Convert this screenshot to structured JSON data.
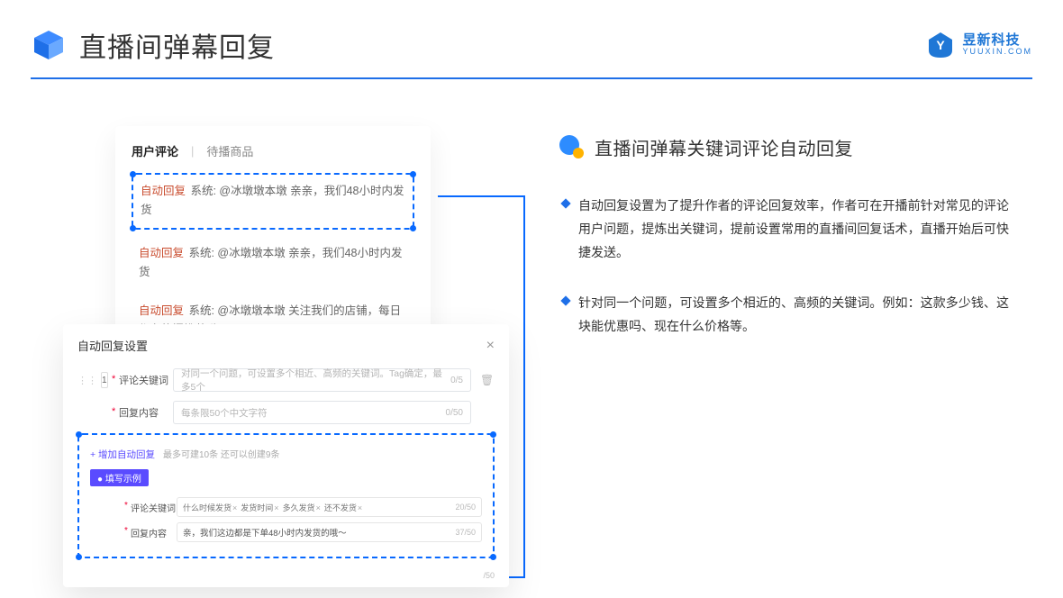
{
  "page": {
    "title": "直播间弹幕回复"
  },
  "brand": {
    "cn": "昱新科技",
    "en": "YUUXIN.COM"
  },
  "card": {
    "tab_active": "用户评论",
    "tab_inactive": "待播商品",
    "msg1_badge": "自动回复",
    "msg1_text": " 系统: @冰墩墩本墩 亲亲，我们48小时内发货",
    "msg2_badge": "自动回复",
    "msg2_text": " 系统: @冰墩墩本墩 亲亲，我们48小时内发货",
    "msg3_badge": "自动回复",
    "msg3_text": " 系统: @冰墩墩本墩 关注我们的店铺，每日都有热门推荐呦～"
  },
  "modal": {
    "title": "自动回复设置",
    "index": "1",
    "row1_label": "评论关键词",
    "row1_placeholder": "对同一个问题，可设置多个相近、高频的关键词。Tag确定，最多5个",
    "row1_count": "0/5",
    "row2_label": "回复内容",
    "row2_placeholder": "每条限50个中文字符",
    "row2_count": "0/50",
    "add_link": "+ 增加自动回复",
    "add_hint": "最多可建10条 还可以创建9条",
    "pill": "● 填写示例",
    "ex_row1_label": "评论关键词",
    "ex_tags": [
      "什么时候发货",
      "发货时间",
      "多久发货",
      "还不发货"
    ],
    "ex_row1_count": "20/50",
    "ex_row2_label": "回复内容",
    "ex_row2_value": "亲，我们这边都是下单48小时内发货的哦～",
    "ex_row2_count": "37/50",
    "bottom_count": "/50"
  },
  "section": {
    "title": "直播间弹幕关键词评论自动回复",
    "bullet1": "自动回复设置为了提升作者的评论回复效率，作者可在开播前针对常见的评论用户问题，提炼出关键词，提前设置常用的直播间回复话术，直播开始后可快捷发送。",
    "bullet2": "针对同一个问题，可设置多个相近的、高频的关键词。例如：这款多少钱、这块能优惠吗、现在什么价格等。"
  }
}
